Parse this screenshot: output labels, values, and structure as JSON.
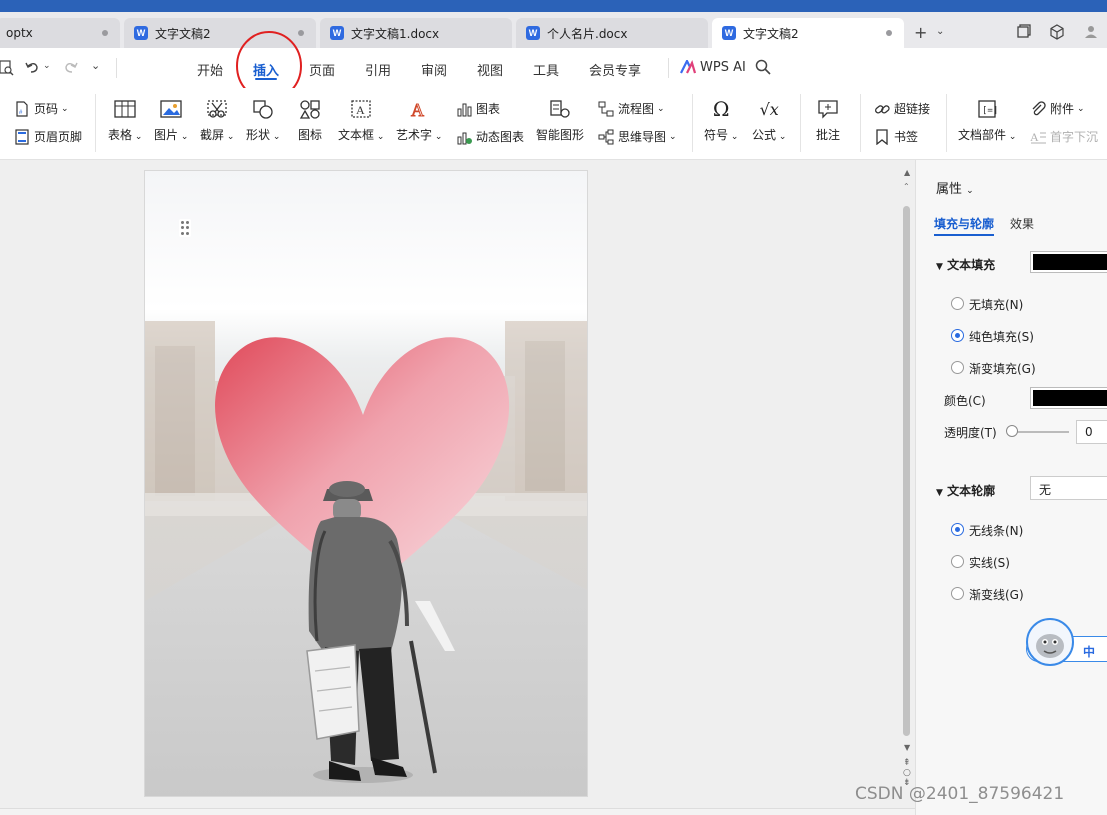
{
  "tabs": [
    {
      "label": "optx",
      "active": false,
      "doc_icon": false
    },
    {
      "label": "文字文稿2",
      "active": false,
      "doc_icon": true
    },
    {
      "label": "文字文稿1.docx",
      "active": false,
      "doc_icon": true
    },
    {
      "label": "个人名片.docx",
      "active": false,
      "doc_icon": true
    },
    {
      "label": "文字文稿2",
      "active": true,
      "doc_icon": true
    }
  ],
  "doc_icon_letter": "W",
  "menu": {
    "items": [
      "开始",
      "插入",
      "页面",
      "引用",
      "审阅",
      "视图",
      "工具",
      "会员专享"
    ],
    "active": "插入",
    "wps_ai": "WPS AI"
  },
  "ribbon": {
    "page_number": "页码",
    "header_footer": "页眉页脚",
    "table": "表格",
    "picture": "图片",
    "screenshot": "截屏",
    "shape": "形状",
    "icons": "图标",
    "textbox": "文本框",
    "wordart": "艺术字",
    "chart": "图表",
    "dynamic_chart": "动态图表",
    "smart_graphic": "智能图形",
    "flowchart": "流程图",
    "mindmap": "思维导图",
    "symbol": "符号",
    "formula": "公式",
    "comment": "批注",
    "hyperlink": "超链接",
    "bookmark": "书签",
    "attachment": "附件",
    "doc_parts": "文档部件",
    "drop_cap": "首字下沉"
  },
  "panel": {
    "title": "属性",
    "tabs": [
      "填充与轮廓",
      "效果"
    ],
    "text_fill": {
      "heading": "文本填充",
      "options": [
        "无填充(N)",
        "纯色填充(S)",
        "渐变填充(G)"
      ],
      "selected": 1,
      "color_label": "颜色(C)",
      "color_value": "#000000",
      "transparency_label": "透明度(T)",
      "transparency_value": "0"
    },
    "text_outline": {
      "heading": "文本轮廓",
      "value": "无",
      "options": [
        "无线条(N)",
        "实线(S)",
        "渐变线(G)"
      ],
      "selected": 0
    },
    "assistant_label": "中"
  },
  "watermark": "CSDN @2401_87596421",
  "colors": {
    "accent": "#1a5fd0",
    "annotation": "#e02020",
    "heart_top": "#e04a5a",
    "heart_bottom": "#f7d8dc"
  }
}
